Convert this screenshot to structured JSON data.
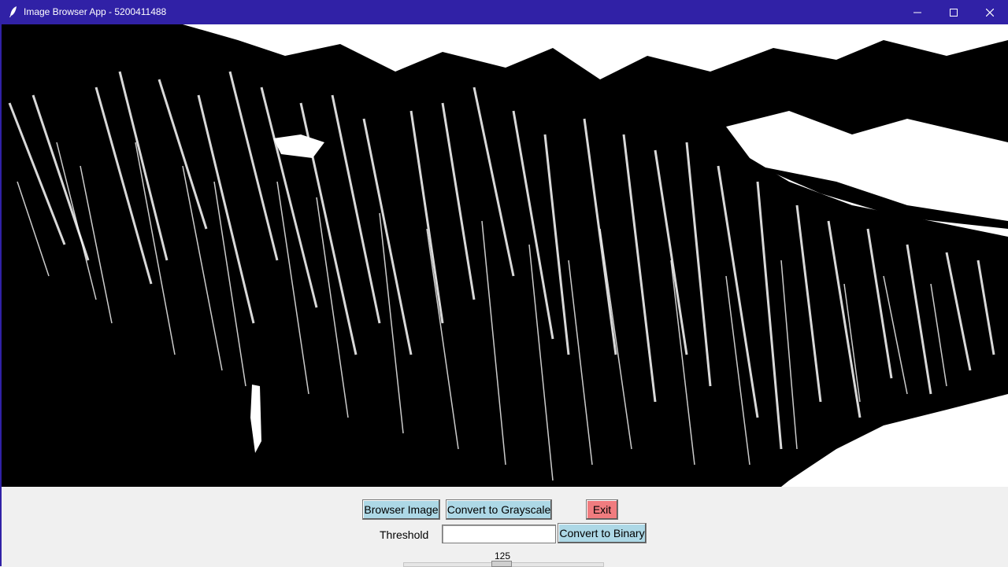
{
  "window": {
    "title": "Image Browser App - 5200411488",
    "icon": "feather-icon",
    "controls": [
      "minimize-icon",
      "maximize-icon",
      "close-icon"
    ]
  },
  "image": {
    "description_icon": "binary-mountain-image"
  },
  "toolbar": {
    "browse_label": "Browser Image",
    "grayscale_label": "Convert to Grayscale",
    "exit_label": "Exit",
    "threshold_label": "Threshold",
    "threshold_value": "",
    "binary_label": "Convert to Binary"
  },
  "slider": {
    "value": "125",
    "min": 0,
    "max": 255
  },
  "colors": {
    "titlebar": "#3021a6",
    "button_blue": "#add8e6",
    "button_red": "#f07c7f"
  }
}
